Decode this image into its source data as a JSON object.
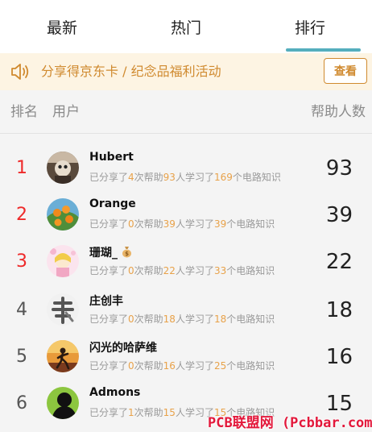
{
  "tabs": [
    {
      "label": "最新"
    },
    {
      "label": "热门"
    },
    {
      "label": "排行"
    }
  ],
  "notice": {
    "text": "分享得京东卡 / 纪念品福利活动",
    "button": "查看"
  },
  "columns": {
    "rank": "排名",
    "user": "用户",
    "helped": "帮助人数"
  },
  "stat_text": {
    "shared": "已分享了",
    "times_help": "次帮助",
    "people_learned": "人学习了",
    "items_knowledge": "个电路知识"
  },
  "rows": [
    {
      "rank": "1",
      "name": "Hubert",
      "shared": "4",
      "helped": "93",
      "learned": "169",
      "count": "93"
    },
    {
      "rank": "2",
      "name": "Orange",
      "shared": "0",
      "helped": "39",
      "learned": "39",
      "count": "39"
    },
    {
      "rank": "3",
      "name": "珊瑚_",
      "shared": "0",
      "helped": "22",
      "learned": "33",
      "count": "22"
    },
    {
      "rank": "4",
      "name": "庄创丰",
      "shared": "0",
      "helped": "18",
      "learned": "18",
      "count": "18"
    },
    {
      "rank": "5",
      "name": "闪光的哈萨维",
      "shared": "0",
      "helped": "16",
      "learned": "25",
      "count": "16"
    },
    {
      "rank": "6",
      "name": "Admons",
      "shared": "1",
      "helped": "15",
      "learned": "15",
      "count": "15"
    }
  ],
  "watermark": "PCB联盟网 (Pcbbar.com)",
  "colors": {
    "accent": "#55aebd",
    "notice_text": "#d08a2f",
    "top_rank": "#ee2a2a",
    "highlight": "#e8a24a"
  }
}
